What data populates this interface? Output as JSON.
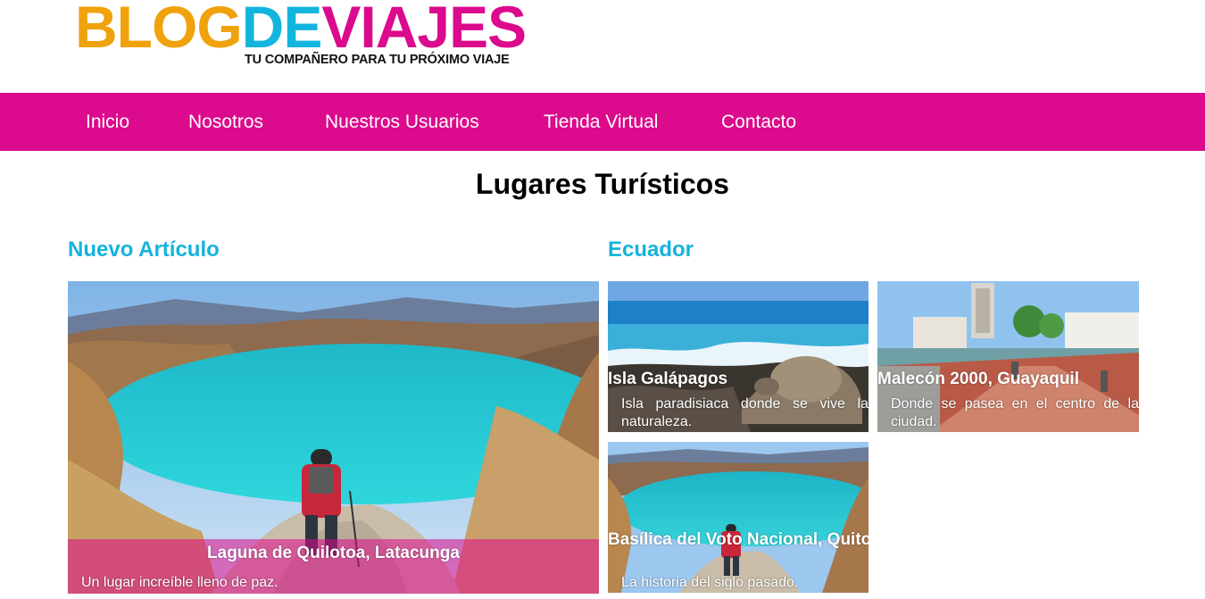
{
  "brand": {
    "part1": "BLOG",
    "part2": "DE",
    "part3": "VIAJES",
    "tagline": "TU COMPAÑERO PARA TU PRÓXIMO VIAJE",
    "colors": {
      "orange": "#f0a20d",
      "cyan": "#12b5dd",
      "magenta": "#dc0a8c"
    }
  },
  "nav": {
    "items": [
      {
        "label": "Inicio"
      },
      {
        "label": "Nosotros"
      },
      {
        "label": "Nuestros Usuarios"
      },
      {
        "label": "Tienda Virtual"
      },
      {
        "label": "Contacto"
      }
    ],
    "background": "#dc0a8c"
  },
  "page": {
    "title": "Lugares Turísticos"
  },
  "sections": {
    "featured": {
      "heading": "Nuevo Artículo",
      "card": {
        "title": "Laguna de Quilotoa, Latacunga",
        "description": "Un lugar increíble lleno de paz."
      }
    },
    "ecuador": {
      "heading": "Ecuador",
      "cards": [
        {
          "title": "Isla Galápagos",
          "description": "Isla paradisiaca donde se vive la naturaleza."
        },
        {
          "title": "Malecón 2000, Guayaquil",
          "description": "Donde se pasea en el centro de la ciudad."
        },
        {
          "title": "Basílica del Voto Nacional, Quito",
          "description": "La historia del siglo pasado."
        }
      ]
    }
  }
}
